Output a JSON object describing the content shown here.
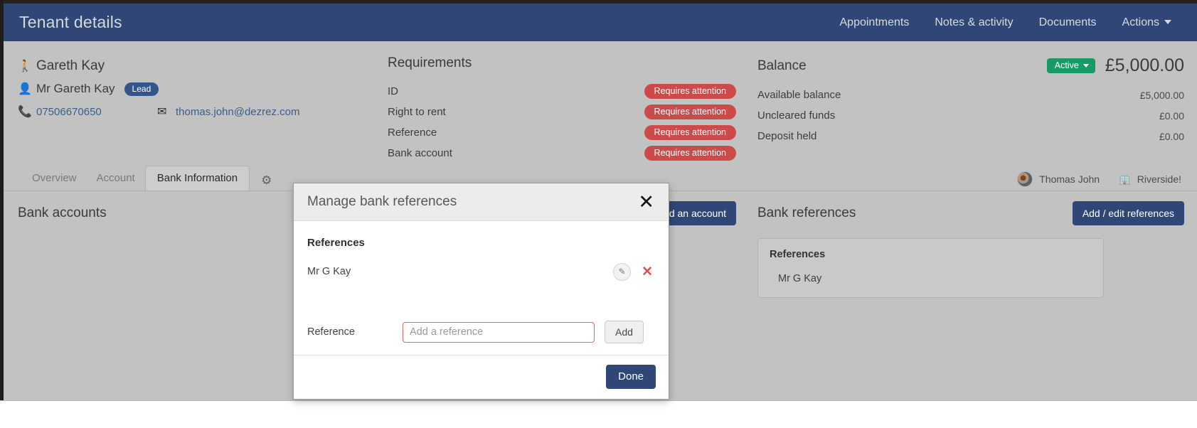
{
  "header": {
    "title": "Tenant details",
    "nav": [
      {
        "label": "Appointments"
      },
      {
        "label": "Notes & activity"
      },
      {
        "label": "Documents"
      },
      {
        "label": "Actions",
        "has_caret": true
      }
    ]
  },
  "contact": {
    "person_icon": "person-standing-icon",
    "name": "Gareth Kay",
    "title_name": "Mr Gareth Kay",
    "tag": "Lead",
    "phone": "07506670650",
    "email": "thomas.john@dezrez.com"
  },
  "requirements": {
    "title": "Requirements",
    "badge_label": "Requires attention",
    "items": [
      {
        "label": "ID",
        "status": "Requires attention"
      },
      {
        "label": "Right to rent",
        "status": "Requires attention"
      },
      {
        "label": "Reference",
        "status": "Requires attention"
      },
      {
        "label": "Bank account",
        "status": "Requires attention"
      }
    ]
  },
  "balance": {
    "title": "Balance",
    "status": "Active",
    "total": "£5,000.00",
    "rows": [
      {
        "label": "Available balance",
        "value": "£5,000.00"
      },
      {
        "label": "Uncleared funds",
        "value": "£0.00"
      },
      {
        "label": "Deposit held",
        "value": "£0.00"
      }
    ]
  },
  "tabs": {
    "items": [
      {
        "label": "Overview",
        "active": false
      },
      {
        "label": "Account",
        "active": false
      },
      {
        "label": "Bank Information",
        "active": true
      }
    ],
    "settings_icon": "gear-icon",
    "negotiator": "Thomas John",
    "branch": "Riverside!"
  },
  "bank_accounts": {
    "title": "Bank accounts",
    "add_button": "Add an account"
  },
  "bank_references": {
    "title": "Bank references",
    "edit_button": "Add / edit references",
    "card_title": "References",
    "items": [
      "Mr G Kay"
    ]
  },
  "modal": {
    "title": "Manage bank references",
    "close_icon": "close-icon",
    "section_title": "References",
    "references": [
      {
        "name": "Mr G Kay",
        "edit_icon": "pencil-icon",
        "delete_icon": "remove-icon"
      }
    ],
    "form": {
      "label": "Reference",
      "placeholder": "Add a reference",
      "value": "",
      "add_button": "Add"
    },
    "done_button": "Done"
  },
  "colors": {
    "header_blue": "#2f4676",
    "danger_red": "#cb4b4b",
    "success_green": "#169b62",
    "page_gray": "#c2c2c2",
    "input_error_border": "#e8675f"
  }
}
